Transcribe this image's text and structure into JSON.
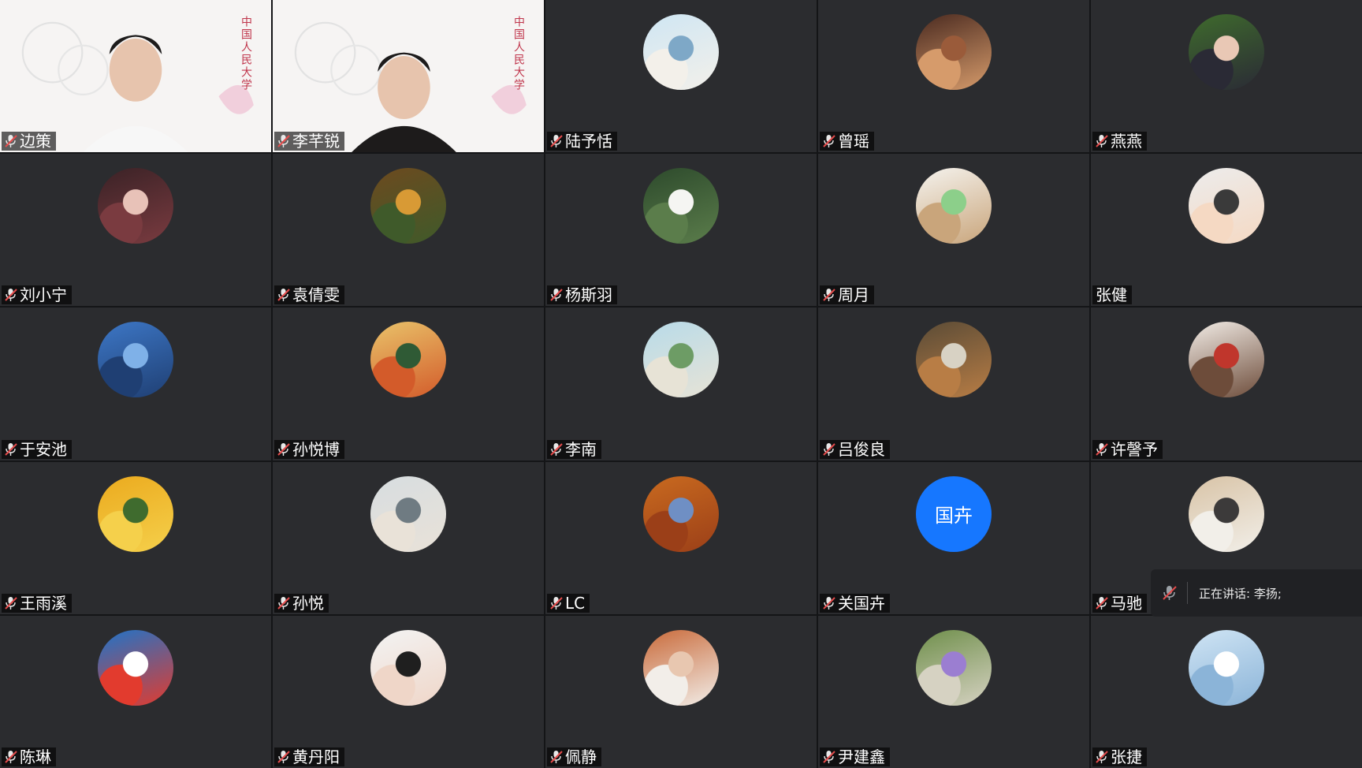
{
  "participants": [
    {
      "name": "边策",
      "type": "video"
    },
    {
      "name": "李芊锐",
      "type": "video"
    },
    {
      "name": "陆予恬",
      "type": "avatar",
      "colors": [
        "#cfe6f3",
        "#7ea8c7",
        "#f3f0ea"
      ]
    },
    {
      "name": "曾瑶",
      "type": "avatar",
      "colors": [
        "#4a2a20",
        "#9a5b3a",
        "#d69b6b"
      ]
    },
    {
      "name": "燕燕",
      "type": "avatar",
      "colors": [
        "#3f6b2d",
        "#e9c8b5",
        "#2a2a35"
      ]
    },
    {
      "name": "刘小宁",
      "type": "avatar",
      "colors": [
        "#3a2226",
        "#e8c2b8",
        "#7a3b40"
      ]
    },
    {
      "name": "袁倩雯",
      "type": "avatar",
      "colors": [
        "#6d4a1f",
        "#d89a35",
        "#3f5a2a"
      ]
    },
    {
      "name": "杨斯羽",
      "type": "avatar",
      "colors": [
        "#2d4a2c",
        "#f5f5f2",
        "#5b7d4b"
      ]
    },
    {
      "name": "周月",
      "type": "avatar",
      "colors": [
        "#f5f3ee",
        "#8ccf8a",
        "#c9a57b"
      ]
    },
    {
      "name": "张健",
      "type": "avatar",
      "muted": true,
      "colors": [
        "#ececec",
        "#3a3a3a",
        "#f5d9c3"
      ]
    },
    {
      "name": "于安池",
      "type": "avatar",
      "colors": [
        "#3d77c6",
        "#7fb1e8",
        "#1f3f73"
      ]
    },
    {
      "name": "孙悦博",
      "type": "avatar",
      "colors": [
        "#e9c36a",
        "#2f5a35",
        "#d35b2a"
      ]
    },
    {
      "name": "李南",
      "type": "avatar",
      "colors": [
        "#b8dbe9",
        "#6d9c65",
        "#e7e3d6"
      ]
    },
    {
      "name": "吕俊良",
      "type": "avatar",
      "colors": [
        "#5a4b36",
        "#d8d2c4",
        "#b87d45"
      ]
    },
    {
      "name": "许謦予",
      "type": "avatar",
      "colors": [
        "#f2ece6",
        "#c0362c",
        "#6d4c3a"
      ]
    },
    {
      "name": "王雨溪",
      "type": "avatar",
      "colors": [
        "#ebaa1e",
        "#3f6b2e",
        "#f5d04b"
      ]
    },
    {
      "name": "孙悦",
      "type": "avatar",
      "colors": [
        "#d7dde0",
        "#6f7b82",
        "#e9e2d8"
      ]
    },
    {
      "name": "LC",
      "type": "avatar",
      "colors": [
        "#c96a1f",
        "#6f8fc4",
        "#9b3f18"
      ]
    },
    {
      "name": "关国卉",
      "type": "initials",
      "initials": "国卉",
      "colors": [
        "#1677ff"
      ]
    },
    {
      "name": "马驰",
      "type": "avatar",
      "colors": [
        "#d8c3a6",
        "#3c3a3a",
        "#f2efe9"
      ]
    },
    {
      "name": "陈琳",
      "type": "avatar",
      "colors": [
        "#1f74c9",
        "#ffffff",
        "#e23b2e"
      ]
    },
    {
      "name": "黄丹阳",
      "type": "avatar",
      "colors": [
        "#f3f3f3",
        "#1f1f1f",
        "#efd6c8"
      ]
    },
    {
      "name": "佩静",
      "type": "avatar",
      "colors": [
        "#c96a3a",
        "#e8c7b0",
        "#f2eee9"
      ]
    },
    {
      "name": "尹建鑫",
      "type": "avatar",
      "colors": [
        "#6f8f4b",
        "#9b7ed1",
        "#d6d2c2"
      ]
    },
    {
      "name": "张捷",
      "type": "avatar",
      "colors": [
        "#cfe4f4",
        "#ffffff",
        "#8bb4d8"
      ]
    }
  ],
  "speaking": {
    "label": "正在讲话: 李扬;"
  },
  "video_tiles": {
    "tile0": {
      "banner": "中国人民大学"
    },
    "tile1": {
      "banner": "中国人民大学"
    }
  },
  "colors": {
    "tile_bg": "#2b2c2f",
    "name_bg": "rgba(0,0,0,0.62)",
    "mic_red": "#e54b4b"
  }
}
